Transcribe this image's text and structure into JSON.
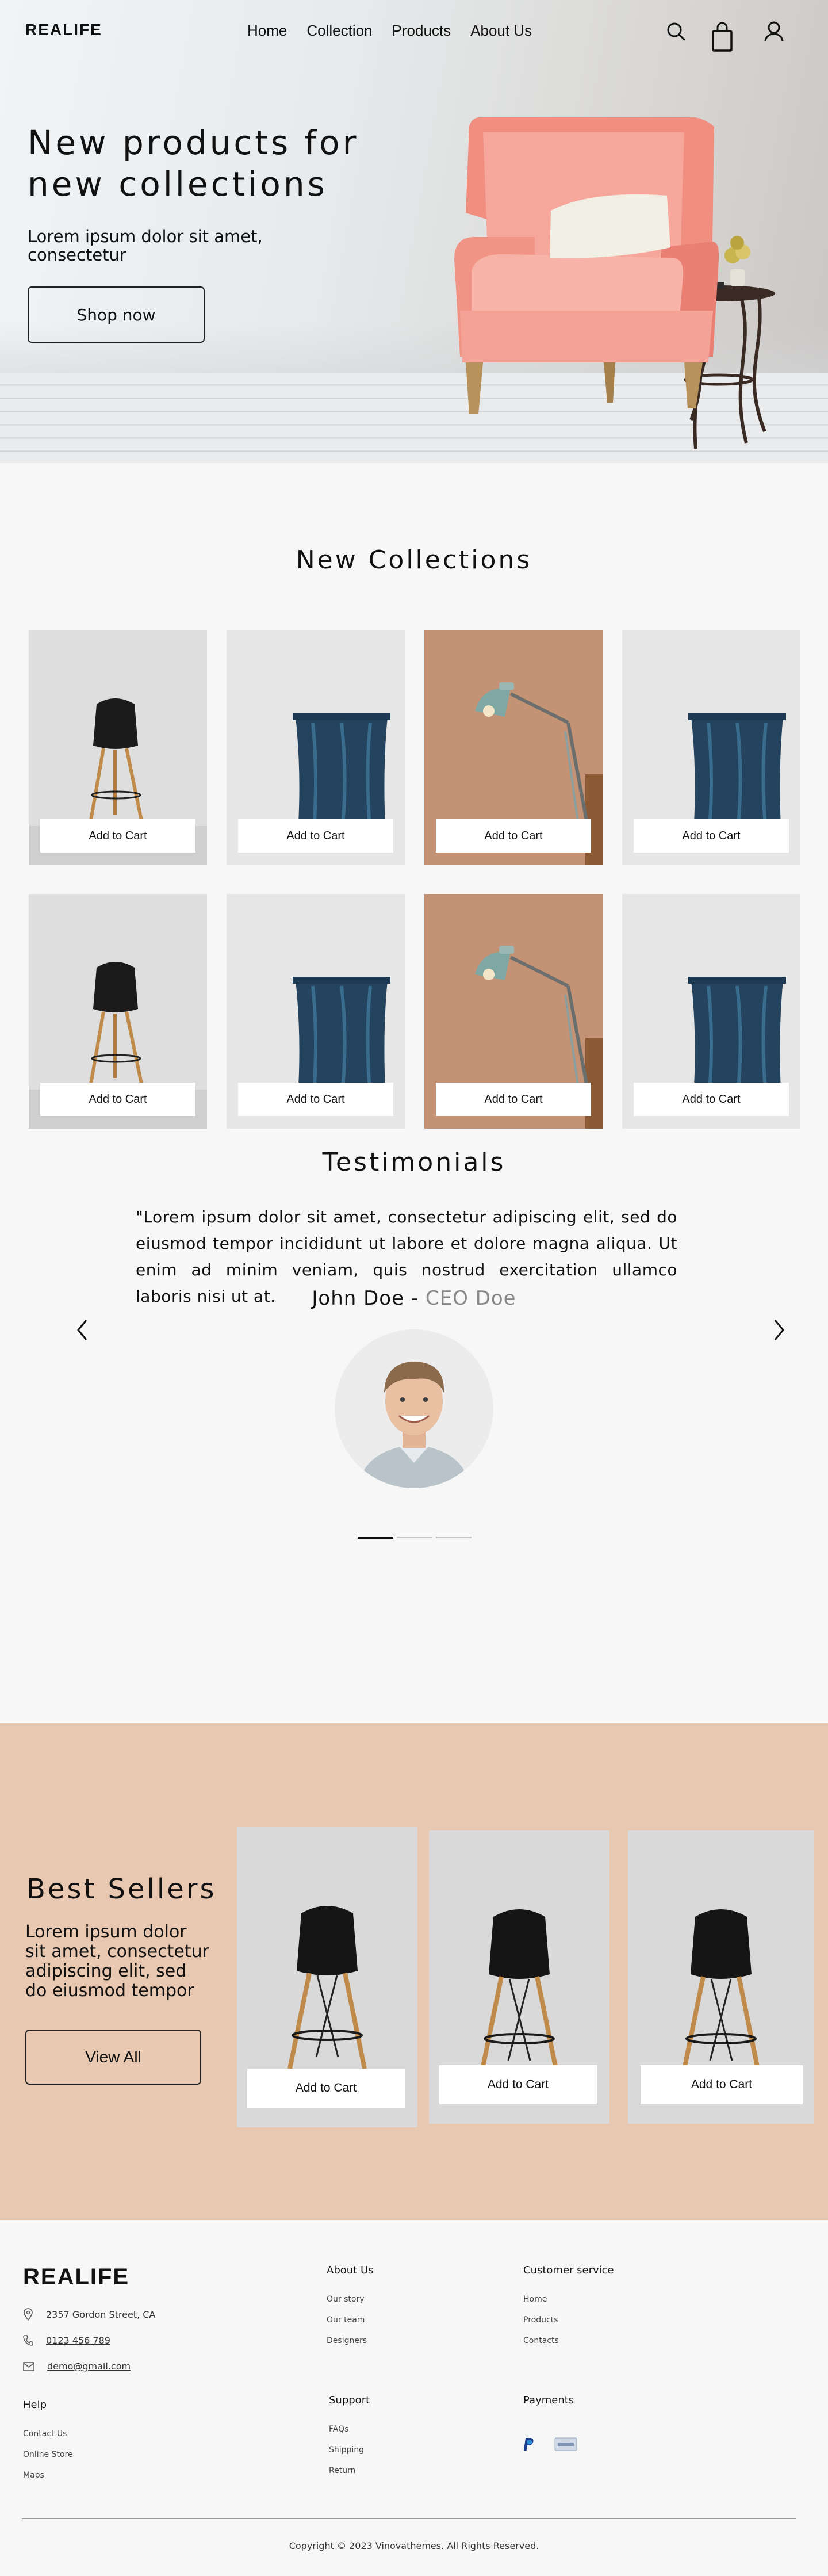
{
  "brand": "REALIFE",
  "nav": {
    "links": [
      "Home",
      "Collection",
      "Products",
      "About Us"
    ]
  },
  "hero": {
    "title_line1": "New products for",
    "title_line2": "new collections",
    "subtitle": "Lorem ipsum dolor sit amet, consectetur",
    "cta": "Shop now"
  },
  "collections": {
    "title": "New Collections",
    "add_to_cart": "Add to Cart"
  },
  "testimonials": {
    "title": "Testimonials",
    "quote": "\"Lorem ipsum dolor sit amet, consectetur adipiscing elit, sed do eiusmod tempor incididunt ut labore et dolore magna aliqua. Ut enim ad minim veniam, quis nostrud exercitation ullamco laboris nisi ut at.",
    "name": "John Doe",
    "separator": " - ",
    "role": "CEO Doe",
    "active_slide": 1,
    "slide_count": 3
  },
  "best_sellers": {
    "title": "Best Sellers",
    "subtitle": "Lorem ipsum dolor sit amet, consectetur adipiscing elit, sed do eiusmod tempor",
    "cta": "View All",
    "add_to_cart": "Add to Cart"
  },
  "footer": {
    "brand": "REALIFE",
    "address": "2357 Gordon Street, CA",
    "phone": "0123 456 789",
    "email": "demo@gmail.com",
    "about": {
      "heading": "About Us",
      "links": [
        "Our story",
        "Our team",
        "Designers"
      ]
    },
    "customer_service": {
      "heading": "Customer service",
      "links": [
        "Home",
        "Products",
        "Contacts"
      ]
    },
    "help": {
      "heading": "Help",
      "links": [
        "Contact Us",
        "Online Store",
        "Maps"
      ]
    },
    "support": {
      "heading": "Support",
      "links": [
        "FAQs",
        "Shipping",
        "Return"
      ]
    },
    "payments": {
      "heading": "Payments"
    },
    "copyright": "Copyright © 2023 Vinovathemes. All Rights Reserved."
  },
  "colors": {
    "accent_section": "#e8c8b0",
    "chair_pink": "#f29c8e",
    "lamp_bg": "#c49274"
  }
}
